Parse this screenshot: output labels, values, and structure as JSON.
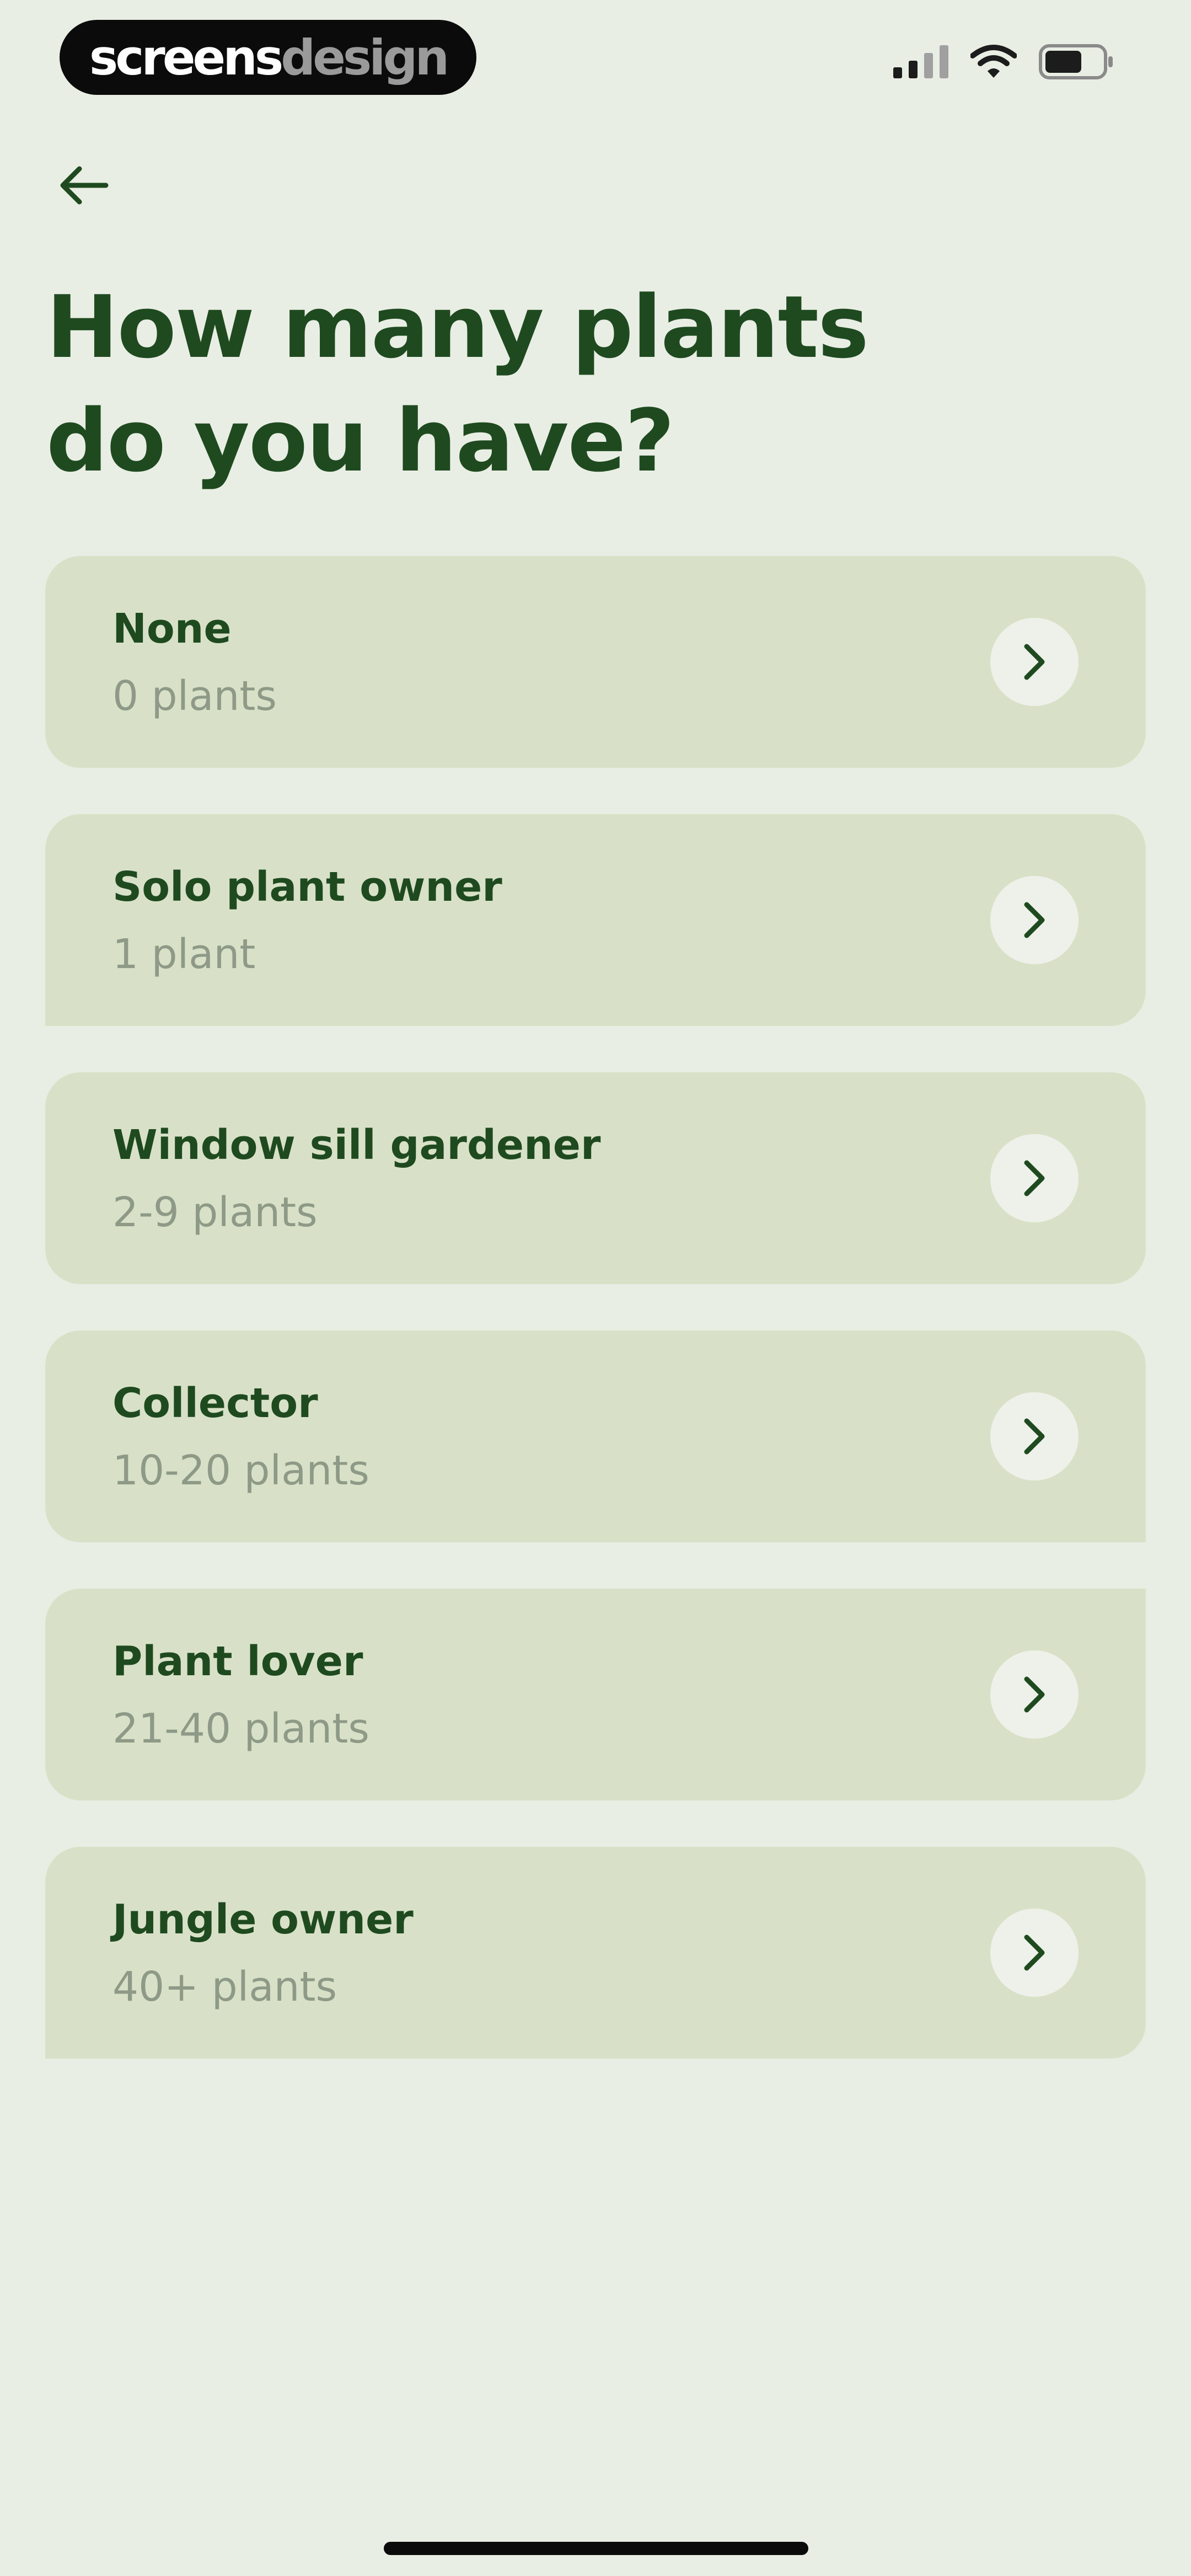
{
  "logo": {
    "part1": "screens",
    "part2": "design"
  },
  "status_bar": {
    "signal_icon": "cellular-signal-icon",
    "wifi_icon": "wifi-icon",
    "battery_icon": "battery-icon",
    "battery_level": 0.65
  },
  "header": {
    "back_icon": "arrow-left-icon",
    "title": "How many plants do you have?"
  },
  "options": [
    {
      "title": "None",
      "subtitle": "0 plants"
    },
    {
      "title": "Solo plant owner",
      "subtitle": "1 plant"
    },
    {
      "title": "Window sill gardener",
      "subtitle": "2-9 plants"
    },
    {
      "title": "Collector",
      "subtitle": "10-20 plants"
    },
    {
      "title": "Plant lover",
      "subtitle": "21-40 plants"
    },
    {
      "title": "Jungle owner",
      "subtitle": "40+ plants"
    }
  ],
  "colors": {
    "background": "#E9EEE4",
    "card": "#D8E1C7",
    "primary_text": "#1F4A20",
    "secondary_text": "#8E9A87",
    "chevron_circle": "#EEF1EA"
  }
}
